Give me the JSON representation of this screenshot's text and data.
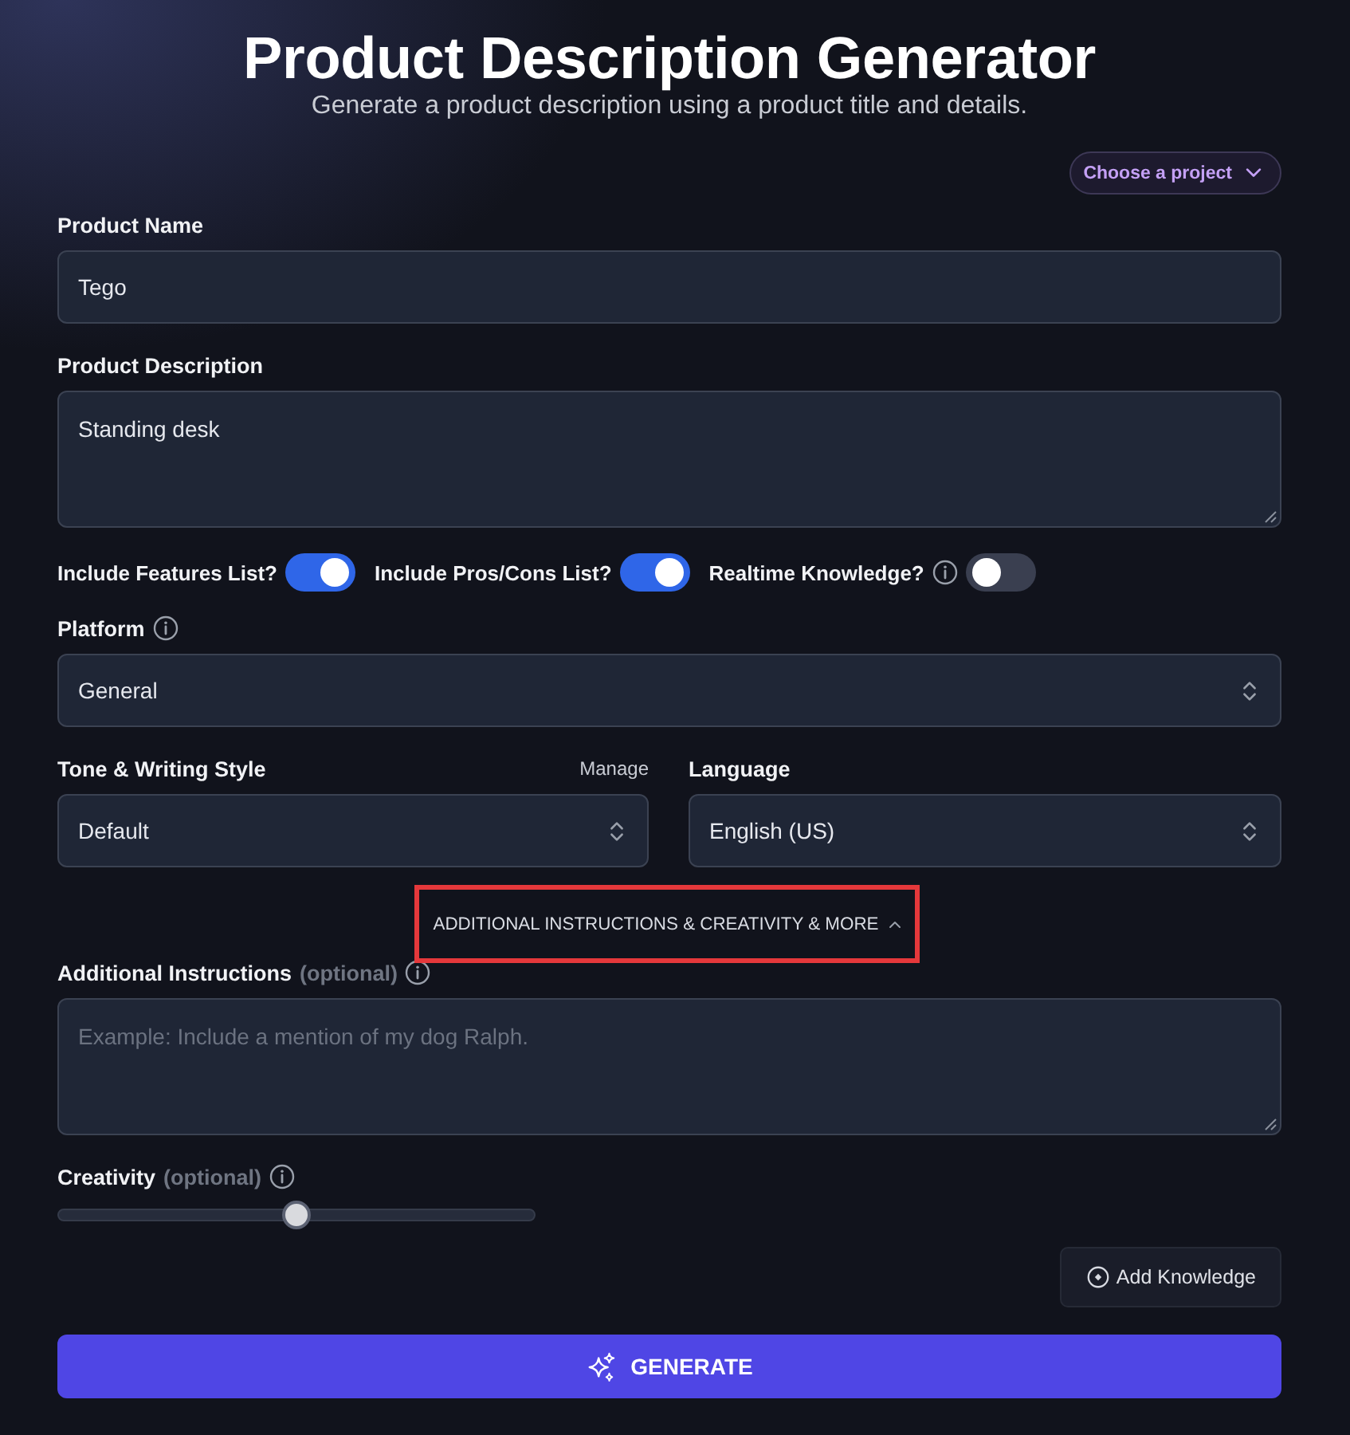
{
  "header": {
    "title": "Product Description Generator",
    "subtitle": "Generate a product description using a product title and details."
  },
  "project_picker": {
    "label": "Choose a project"
  },
  "product_name": {
    "label": "Product Name",
    "value": "Tego"
  },
  "product_description": {
    "label": "Product Description",
    "value": "Standing desk"
  },
  "toggles": [
    {
      "label": "Include Features List?",
      "on": true,
      "info": false
    },
    {
      "label": "Include Pros/Cons List?",
      "on": true,
      "info": false
    },
    {
      "label": "Realtime Knowledge?",
      "on": false,
      "info": true
    }
  ],
  "platform": {
    "label": "Platform",
    "value": "General"
  },
  "tone": {
    "label": "Tone & Writing Style",
    "link": "Manage",
    "value": "Default"
  },
  "language": {
    "label": "Language",
    "value": "English (US)"
  },
  "more_section": {
    "label": "ADDITIONAL INSTRUCTIONS & CREATIVITY & MORE",
    "expanded": true,
    "highlighted": true
  },
  "additional_instructions": {
    "label": "Additional Instructions",
    "hint": "(optional)",
    "placeholder": "Example: Include a mention of my dog Ralph."
  },
  "creativity": {
    "label": "Creativity",
    "hint": "(optional)",
    "level": 0.5
  },
  "add_knowledge": {
    "label": "Add Knowledge"
  },
  "generate": {
    "label": "GENERATE"
  }
}
